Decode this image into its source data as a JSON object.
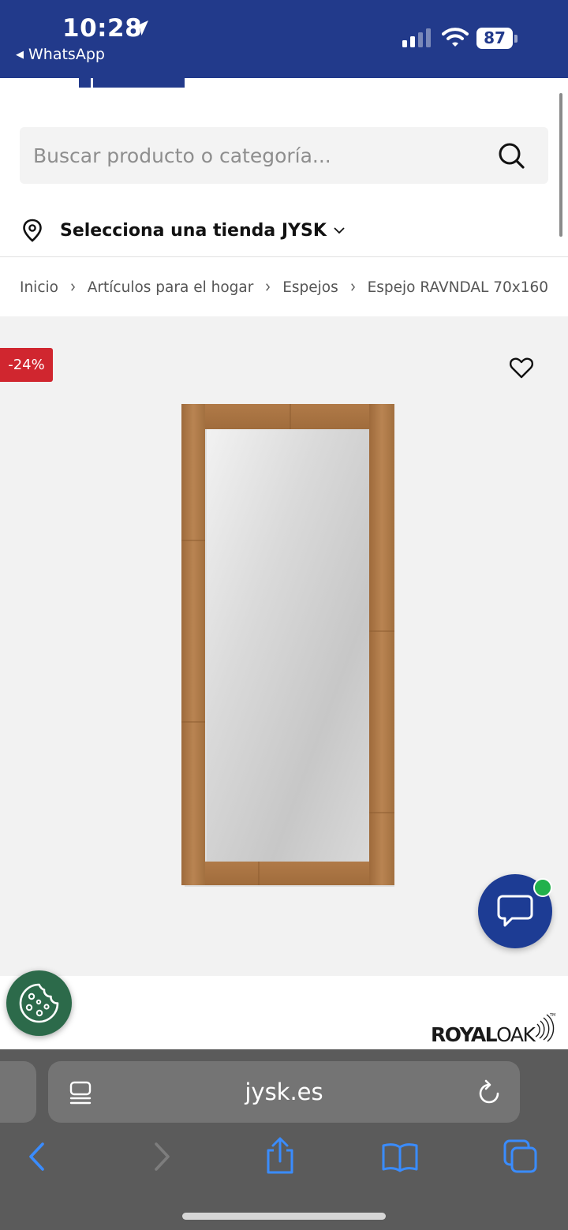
{
  "status_bar": {
    "time": "10:28",
    "back_app": "WhatsApp",
    "battery": "87",
    "background": "#223a8b"
  },
  "search": {
    "placeholder": "Buscar producto o categoría..."
  },
  "store": {
    "label": "Selecciona una tienda JYSK"
  },
  "breadcrumb": [
    "Inicio",
    "Artículos para el hogar",
    "Espejos",
    "Espejo RAVNDAL 70x160"
  ],
  "product": {
    "discount_badge": "-24%",
    "brand": {
      "part1": "ROYAL",
      "part2": "OAK",
      "trademark": "TM"
    }
  },
  "browser": {
    "url": "jysk.es"
  },
  "colors": {
    "brand_blue": "#223a8b",
    "badge_red": "#d0262f",
    "chat_blue": "#1d3c94",
    "cookie_green": "#2c6a4a",
    "online_green": "#22b14c",
    "ios_blue": "#3a8cff"
  },
  "icons": [
    "location-arrow-icon",
    "signal-icon",
    "wifi-icon",
    "search-icon",
    "map-pin-icon",
    "chevron-down-icon",
    "chevron-right-icon",
    "heart-icon",
    "chat-bubble-icon",
    "cookie-icon",
    "reader-icon",
    "reload-icon",
    "back-arrow-icon",
    "forward-arrow-icon",
    "share-icon",
    "bookmarks-icon",
    "tabs-icon"
  ]
}
